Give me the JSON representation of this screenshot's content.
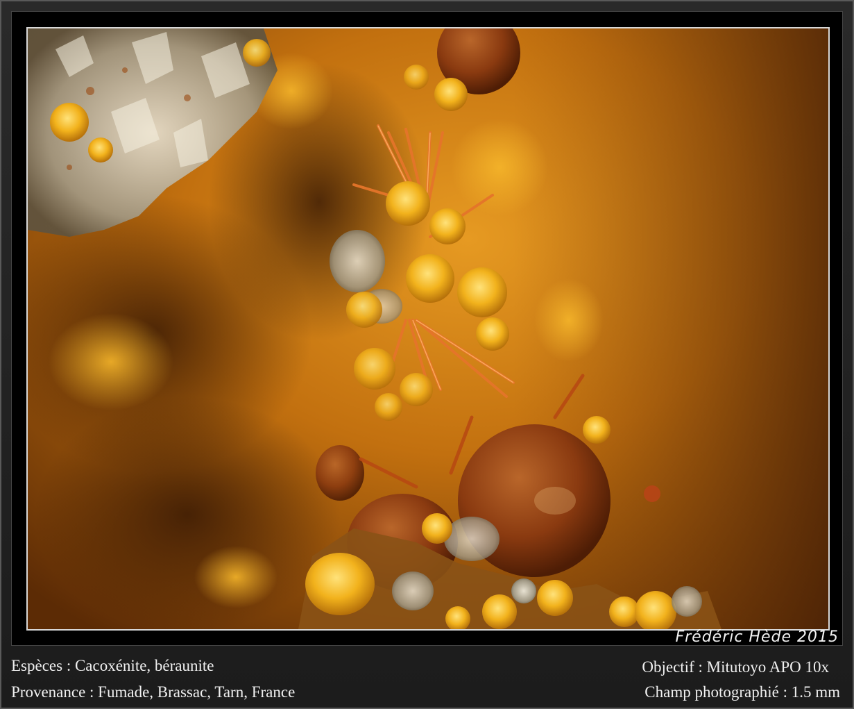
{
  "photo": {
    "subject": "mineral-micro-photograph",
    "palette": {
      "background_warm": "#c97a12",
      "background_dark": "#5a2a06",
      "crystal_yellow": "#f2b21c",
      "needle_orange": "#d0631a",
      "sphere_brown": "#8a3e12",
      "quartz_white": "#d9d2c0"
    }
  },
  "credit": "Frédéric Hède 2015",
  "captions": {
    "species": "Espèces : Cacoxénite, béraunite",
    "provenance": "Provenance : Fumade, Brassac, Tarn, France",
    "objective": "Objectif : Mitutoyo APO 10x",
    "field": "Champ photographié : 1.5 mm"
  }
}
